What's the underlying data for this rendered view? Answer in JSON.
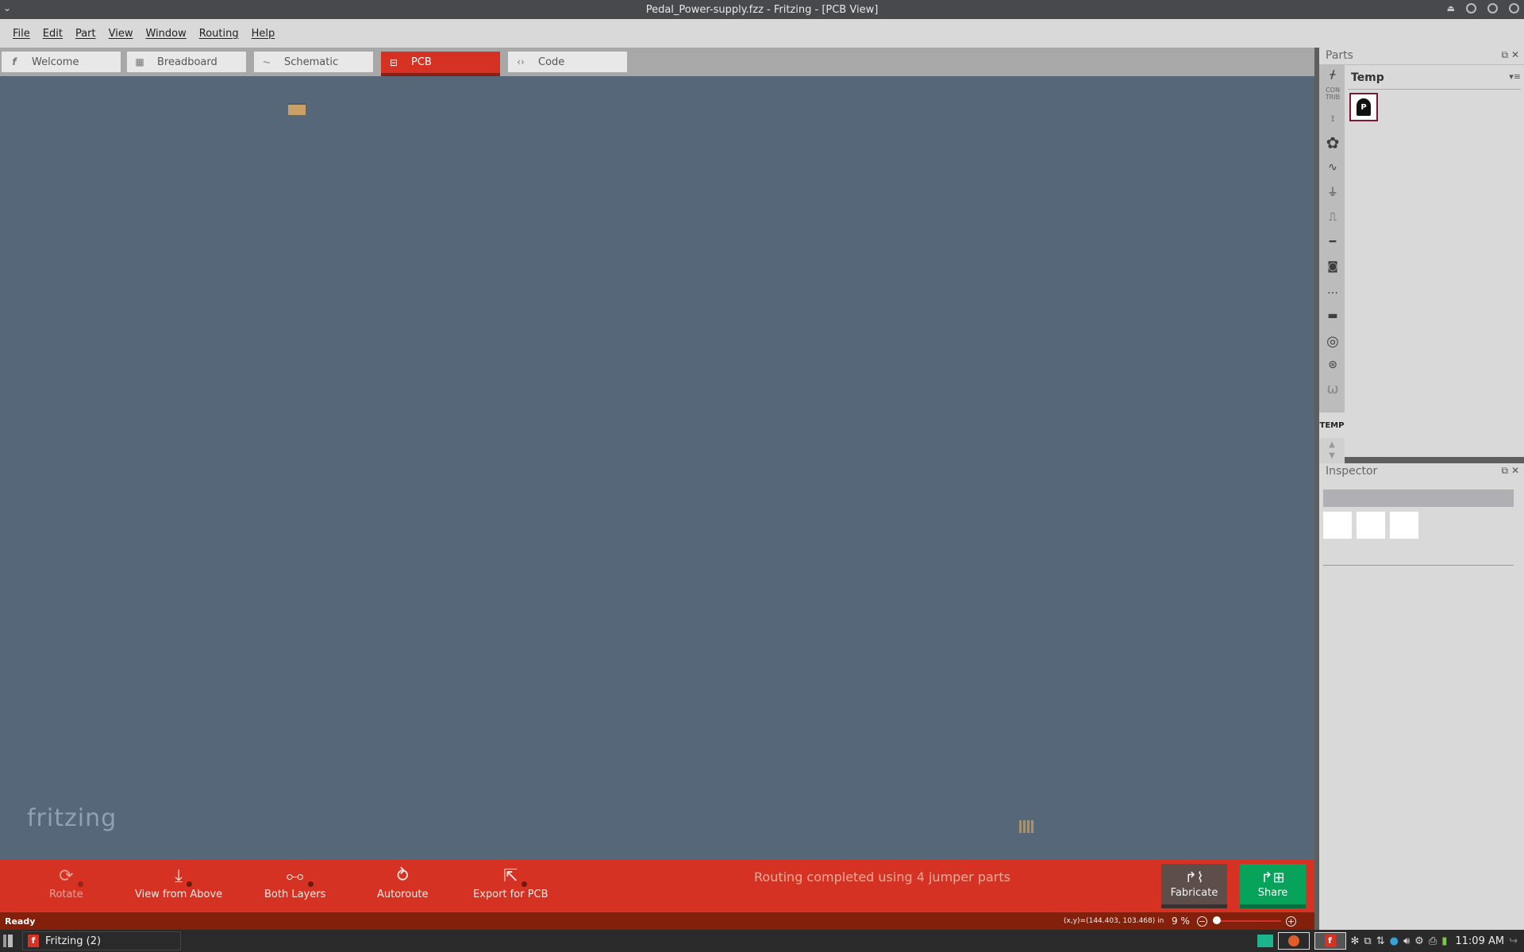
{
  "window": {
    "title": "Pedal_Power-supply.fzz - Fritzing - [PCB View]"
  },
  "menubar": {
    "items": [
      "File",
      "Edit",
      "Part",
      "View",
      "Window",
      "Routing",
      "Help"
    ]
  },
  "tabs": [
    {
      "label": "Welcome",
      "icon": "fritzing-f-icon",
      "active": false
    },
    {
      "label": "Breadboard",
      "icon": "breadboard-icon",
      "active": false
    },
    {
      "label": "Schematic",
      "icon": "resistor-icon",
      "active": false
    },
    {
      "label": "PCB",
      "icon": "pcb-icon",
      "active": true
    },
    {
      "label": "Code",
      "icon": "code-icon",
      "active": false
    }
  ],
  "canvas": {
    "logo_text": "fritzing",
    "background": "#566779"
  },
  "toolbar": {
    "buttons": [
      {
        "label": "Rotate",
        "icon": "rotate-icon",
        "has_dropdown": true,
        "enabled": false
      },
      {
        "label": "View from Above",
        "icon": "view-from-above-icon",
        "has_dropdown": true,
        "enabled": true
      },
      {
        "label": "Both Layers",
        "icon": "both-layers-icon",
        "has_dropdown": true,
        "enabled": true
      },
      {
        "label": "Autoroute",
        "icon": "autoroute-icon",
        "has_dropdown": false,
        "enabled": true
      },
      {
        "label": "Export for PCB",
        "icon": "export-icon",
        "has_dropdown": true,
        "enabled": true
      }
    ],
    "routing_status": "Routing completed using 4 jumper parts",
    "fabricate_label": "Fabricate",
    "share_label": "Share",
    "accent": "#d63224",
    "share_color": "#07a35a"
  },
  "statusbar": {
    "status": "Ready",
    "coordinates": "(x,y)=(144.403, 103.468) in",
    "zoom": "9 %"
  },
  "parts_panel": {
    "title": "Parts",
    "bin_title": "Temp",
    "bin_tab_label": "TEMP",
    "contrib_label": "CON TRIB",
    "bins": [
      "core-icon",
      "contrib-icon",
      "sparkfun-icon",
      "seeed-icon",
      "ic-analog-icon",
      "connector-icon",
      "ic-digital-icon",
      "resistor-part-icon",
      "button-icon",
      "more-icon",
      "chip-icon",
      "antenna-icon",
      "motor-icon",
      "wire-icon"
    ],
    "parts": [
      {
        "name": "transistor-p",
        "glyph": "P"
      }
    ]
  },
  "inspector": {
    "title": "Inspector"
  },
  "taskbar": {
    "task_label": "Fritzing (2)",
    "clock": "11:09 AM"
  }
}
